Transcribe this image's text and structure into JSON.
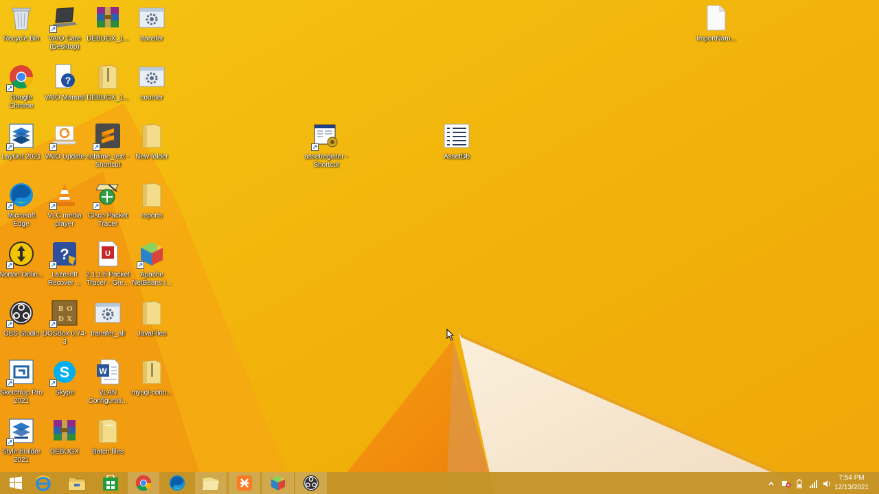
{
  "desktop": {
    "icons": [
      {
        "id": "recycle-bin",
        "label": "Recycle Bin",
        "icon": "recycle-bin-icon"
      },
      {
        "id": "vaio-care",
        "label": "VAIO Care (Desktop)",
        "icon": "laptop-icon"
      },
      {
        "id": "debugx-1",
        "label": "DEBUGX_1...",
        "icon": "winrar-archive-icon"
      },
      {
        "id": "transfer",
        "label": "transfer",
        "icon": "batch-gear-icon"
      },
      {
        "id": "google-chrome",
        "label": "Google Chrome",
        "icon": "chrome-icon"
      },
      {
        "id": "vaio-manual",
        "label": "VAIO Manual",
        "icon": "help-document-icon"
      },
      {
        "id": "debugx-1-folder",
        "label": "DEBUGX_1...",
        "icon": "zip-folder-icon"
      },
      {
        "id": "counter",
        "label": "counter",
        "icon": "batch-gear-icon"
      },
      {
        "id": "layout-2021",
        "label": "LayOut 2021",
        "icon": "layout-icon"
      },
      {
        "id": "vaio-update",
        "label": "VAIO Update",
        "icon": "update-icon"
      },
      {
        "id": "sublime-text",
        "label": "sublime_text - Shortcut",
        "icon": "sublime-icon"
      },
      {
        "id": "new-folder",
        "label": "New folder",
        "icon": "folder-icon"
      },
      {
        "id": "microsoft-edge",
        "label": "Microsoft Edge",
        "icon": "edge-icon"
      },
      {
        "id": "vlc",
        "label": "VLC media player",
        "icon": "vlc-cone-icon"
      },
      {
        "id": "cisco-packet-tracer",
        "label": "Cisco Packet Tracer",
        "icon": "packet-tracer-icon"
      },
      {
        "id": "reports",
        "label": "reports",
        "icon": "folder-icon"
      },
      {
        "id": "norton",
        "label": "Norton Onlin...",
        "icon": "norton-icon"
      },
      {
        "id": "lazesoft",
        "label": "Lazesoft Recover ...",
        "icon": "lazesoft-icon"
      },
      {
        "id": "packet-tracer-gre",
        "label": "2.1.1.5 Packet Tracer - Gre...",
        "icon": "pdf-document-icon"
      },
      {
        "id": "apache-netbeans",
        "label": "Apache NetBeans I...",
        "icon": "netbeans-cube-icon"
      },
      {
        "id": "obs-studio",
        "label": "OBS Studio",
        "icon": "obs-icon"
      },
      {
        "id": "dosbox",
        "label": "DOSBox 0.74-3",
        "icon": "dosbox-icon"
      },
      {
        "id": "transfer-all",
        "label": "transfer_all",
        "icon": "batch-gear-icon"
      },
      {
        "id": "javafiles",
        "label": "JavaFiles",
        "icon": "folder-icon"
      },
      {
        "id": "sketchup-pro",
        "label": "SketchUp Pro 2021",
        "icon": "sketchup-icon"
      },
      {
        "id": "skype",
        "label": "Skype",
        "icon": "skype-icon"
      },
      {
        "id": "vlan-config",
        "label": "VLAN Configurati...",
        "icon": "word-document-icon"
      },
      {
        "id": "mysql-conn",
        "label": "mysql-conn...",
        "icon": "zip-folder-icon"
      },
      {
        "id": "style-builder",
        "label": "Style Builder 2021",
        "icon": "style-builder-icon"
      },
      {
        "id": "debugx",
        "label": "DEBUGX",
        "icon": "winrar-archive-icon"
      },
      {
        "id": "batch-files",
        "label": "Batch files",
        "icon": "folder-icon"
      },
      {
        "id": "assetregister",
        "label": "assetregister - Shortcut",
        "icon": "database-app-icon"
      },
      {
        "id": "assetdb",
        "label": "AssetDb",
        "icon": "list-document-icon"
      },
      {
        "id": "importnam",
        "label": "ImportNam...",
        "icon": "blank-file-icon"
      }
    ]
  },
  "taskbar": {
    "buttons": [
      {
        "id": "start",
        "icon": "windows-start-icon"
      },
      {
        "id": "internet-explorer",
        "icon": "internet-explorer-icon"
      },
      {
        "id": "file-explorer",
        "icon": "file-explorer-icon"
      },
      {
        "id": "store",
        "icon": "store-icon"
      },
      {
        "id": "chrome",
        "icon": "chrome-icon"
      },
      {
        "id": "edge",
        "icon": "edge-icon"
      },
      {
        "id": "folder-window",
        "icon": "folder-icon"
      },
      {
        "id": "xampp",
        "icon": "xampp-icon"
      },
      {
        "id": "netbeans",
        "icon": "netbeans-cube-icon"
      },
      {
        "id": "obs",
        "icon": "obs-icon"
      }
    ],
    "tray": {
      "icons": [
        "show-hidden-icons-icon",
        "action-center-icon",
        "power-icon",
        "network-icon",
        "volume-icon"
      ],
      "time": "7:54 PM",
      "date": "12/13/2021"
    }
  },
  "colors": {
    "wallpaper_base": "#f2b40c",
    "wallpaper_dark": "#f08c0c",
    "wallpaper_cream": "#f6e4c8",
    "taskbar": "#c49428"
  }
}
